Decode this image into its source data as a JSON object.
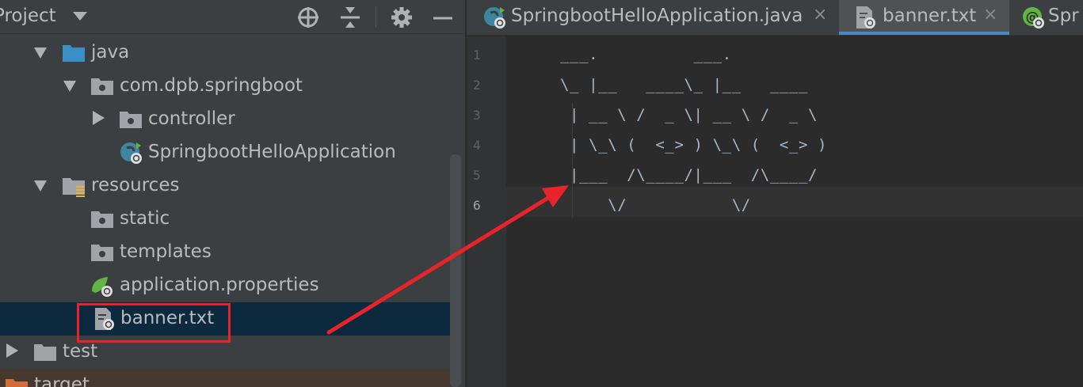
{
  "project_panel": {
    "title": "Project",
    "header_icons": [
      "locate-icon",
      "collapse-icon",
      "gear-icon",
      "hide-icon"
    ],
    "tree": [
      {
        "label": "java",
        "icon": "source-folder-icon",
        "state": "expanded"
      },
      {
        "label": "com.dpb.springboot",
        "icon": "package-icon",
        "state": "expanded"
      },
      {
        "label": "controller",
        "icon": "package-icon",
        "state": "collapsed"
      },
      {
        "label": "SpringbootHelloApplication",
        "icon": "spring-class-icon",
        "state": "leaf"
      },
      {
        "label": "resources",
        "icon": "resources-folder-icon",
        "state": "expanded"
      },
      {
        "label": "static",
        "icon": "folder-icon",
        "state": "leaf"
      },
      {
        "label": "templates",
        "icon": "folder-icon",
        "state": "leaf"
      },
      {
        "label": "application.properties",
        "icon": "spring-properties-icon",
        "state": "leaf"
      },
      {
        "label": "banner.txt",
        "icon": "text-file-icon",
        "state": "selected"
      },
      {
        "label": "test",
        "icon": "folder-icon",
        "state": "collapsed"
      },
      {
        "label": "target",
        "icon": "excluded-folder-icon",
        "state": "leaf"
      }
    ]
  },
  "editor": {
    "tabs": [
      {
        "label": "SpringbootHelloApplication.java",
        "icon": "spring-class-icon",
        "active": false,
        "close": "×"
      },
      {
        "label": "banner.txt",
        "icon": "text-file-icon",
        "active": true,
        "close": "×"
      },
      {
        "label": "Spr",
        "icon": "spring-annotation-icon",
        "active": false
      }
    ],
    "line_numbers": [
      "1",
      "2",
      "3",
      "4",
      "5",
      "6"
    ],
    "code_lines": [
      "___.          ___.",
      "\\_ |__   ____\\_ |__   ____",
      " | __ \\ /  _ \\| __ \\ /  _ \\",
      " | \\_\\ (  <_> ) \\_\\ (  <_> )",
      " |___  /\\____/|___  /\\____/",
      "     \\/           \\/"
    ],
    "current_line": 6
  },
  "colors": {
    "panel_bg": "#3c3f41",
    "editor_bg": "#2b2b2b",
    "selection": "#0d293e",
    "annotation": "#e8242a",
    "active_tab_accent": "#4a88c7"
  }
}
